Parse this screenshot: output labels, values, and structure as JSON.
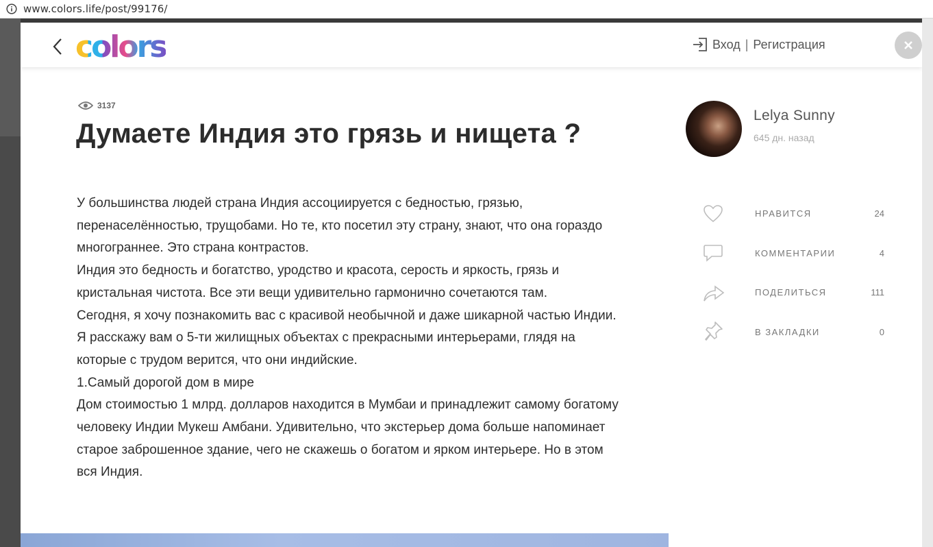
{
  "browser": {
    "url": "www.colors.life/post/99176/"
  },
  "header": {
    "logo_text": "colors",
    "login_label": "Вход",
    "separator": "|",
    "register_label": "Регистрация"
  },
  "post": {
    "views": "3137",
    "title": "Думаете Индия это грязь и нищета ?",
    "paragraphs": [
      "У большинства людей страна Индия ассоциируется с бедностью, грязью, перенаселённостью, трущобами. Но те, кто посетил эту страну, знают, что она гораздо многограннее. Это страна контрастов.",
      "Индия это бедность и богатство, уродство и красота, серость и яркость, грязь и кристальная чистота. Все эти вещи удивительно гармонично сочетаются там.",
      "Сегодня, я хочу познакомить вас с красивой необычной и даже шикарной частью Индии. Я расскажу вам о 5-ти жилищных объектах с прекрасными интерьерами, глядя на которые с трудом верится, что они индийские.",
      "1.Самый дорогой дом в мире",
      "Дом стоимостью 1 млрд. долларов находится в Мумбаи и принадлежит самому богатому человеку Индии Мукеш Амбани. Удивительно, что экстерьер дома больше напоминает старое заброшенное здание, чего не скажешь о богатом и ярком интерьере. Но в этом вся Индия."
    ]
  },
  "author": {
    "name": "Lelya Sunny",
    "time": "645 дн. назад"
  },
  "actions": [
    {
      "icon": "heart-icon",
      "label": "НРАВИТСЯ",
      "count": "24"
    },
    {
      "icon": "comment-icon",
      "label": "КОММЕНТАРИИ",
      "count": "4"
    },
    {
      "icon": "share-icon",
      "label": "ПОДЕЛИТЬСЯ",
      "count": "111"
    },
    {
      "icon": "pin-icon",
      "label": "В ЗАКЛАДКИ",
      "count": "0"
    }
  ],
  "colors": {
    "icon_stroke": "#bdbdbd",
    "text_dark": "#2c2c2c",
    "muted": "#777777"
  }
}
